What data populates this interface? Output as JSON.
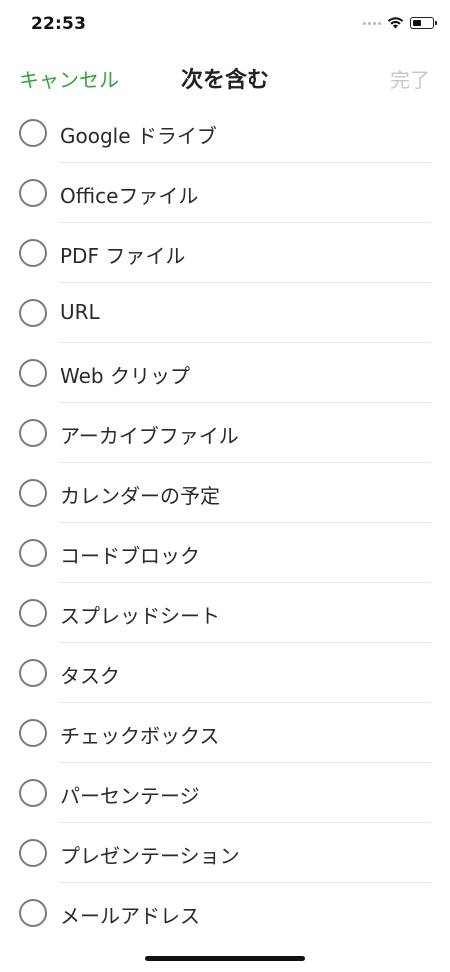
{
  "status_bar": {
    "time": "22:53",
    "signal_icon": "cellular-dots-icon",
    "wifi_icon": "wifi-icon",
    "battery_icon": "battery-icon"
  },
  "nav": {
    "cancel_label": "キャンセル",
    "title": "次を含む",
    "done_label": "完了",
    "accent_color": "#3aa03a",
    "disabled_color": "#c8c8c8"
  },
  "options": [
    {
      "label": "Google ドライブ",
      "selected": false
    },
    {
      "label": "Officeファイル",
      "selected": false
    },
    {
      "label": "PDF ファイル",
      "selected": false
    },
    {
      "label": "URL",
      "selected": false
    },
    {
      "label": "Web クリップ",
      "selected": false
    },
    {
      "label": "アーカイブファイル",
      "selected": false
    },
    {
      "label": "カレンダーの予定",
      "selected": false
    },
    {
      "label": "コードブロック",
      "selected": false
    },
    {
      "label": "スプレッドシート",
      "selected": false
    },
    {
      "label": "タスク",
      "selected": false
    },
    {
      "label": "チェックボックス",
      "selected": false
    },
    {
      "label": "パーセンテージ",
      "selected": false
    },
    {
      "label": "プレゼンテーション",
      "selected": false
    },
    {
      "label": "メールアドレス",
      "selected": false
    }
  ]
}
